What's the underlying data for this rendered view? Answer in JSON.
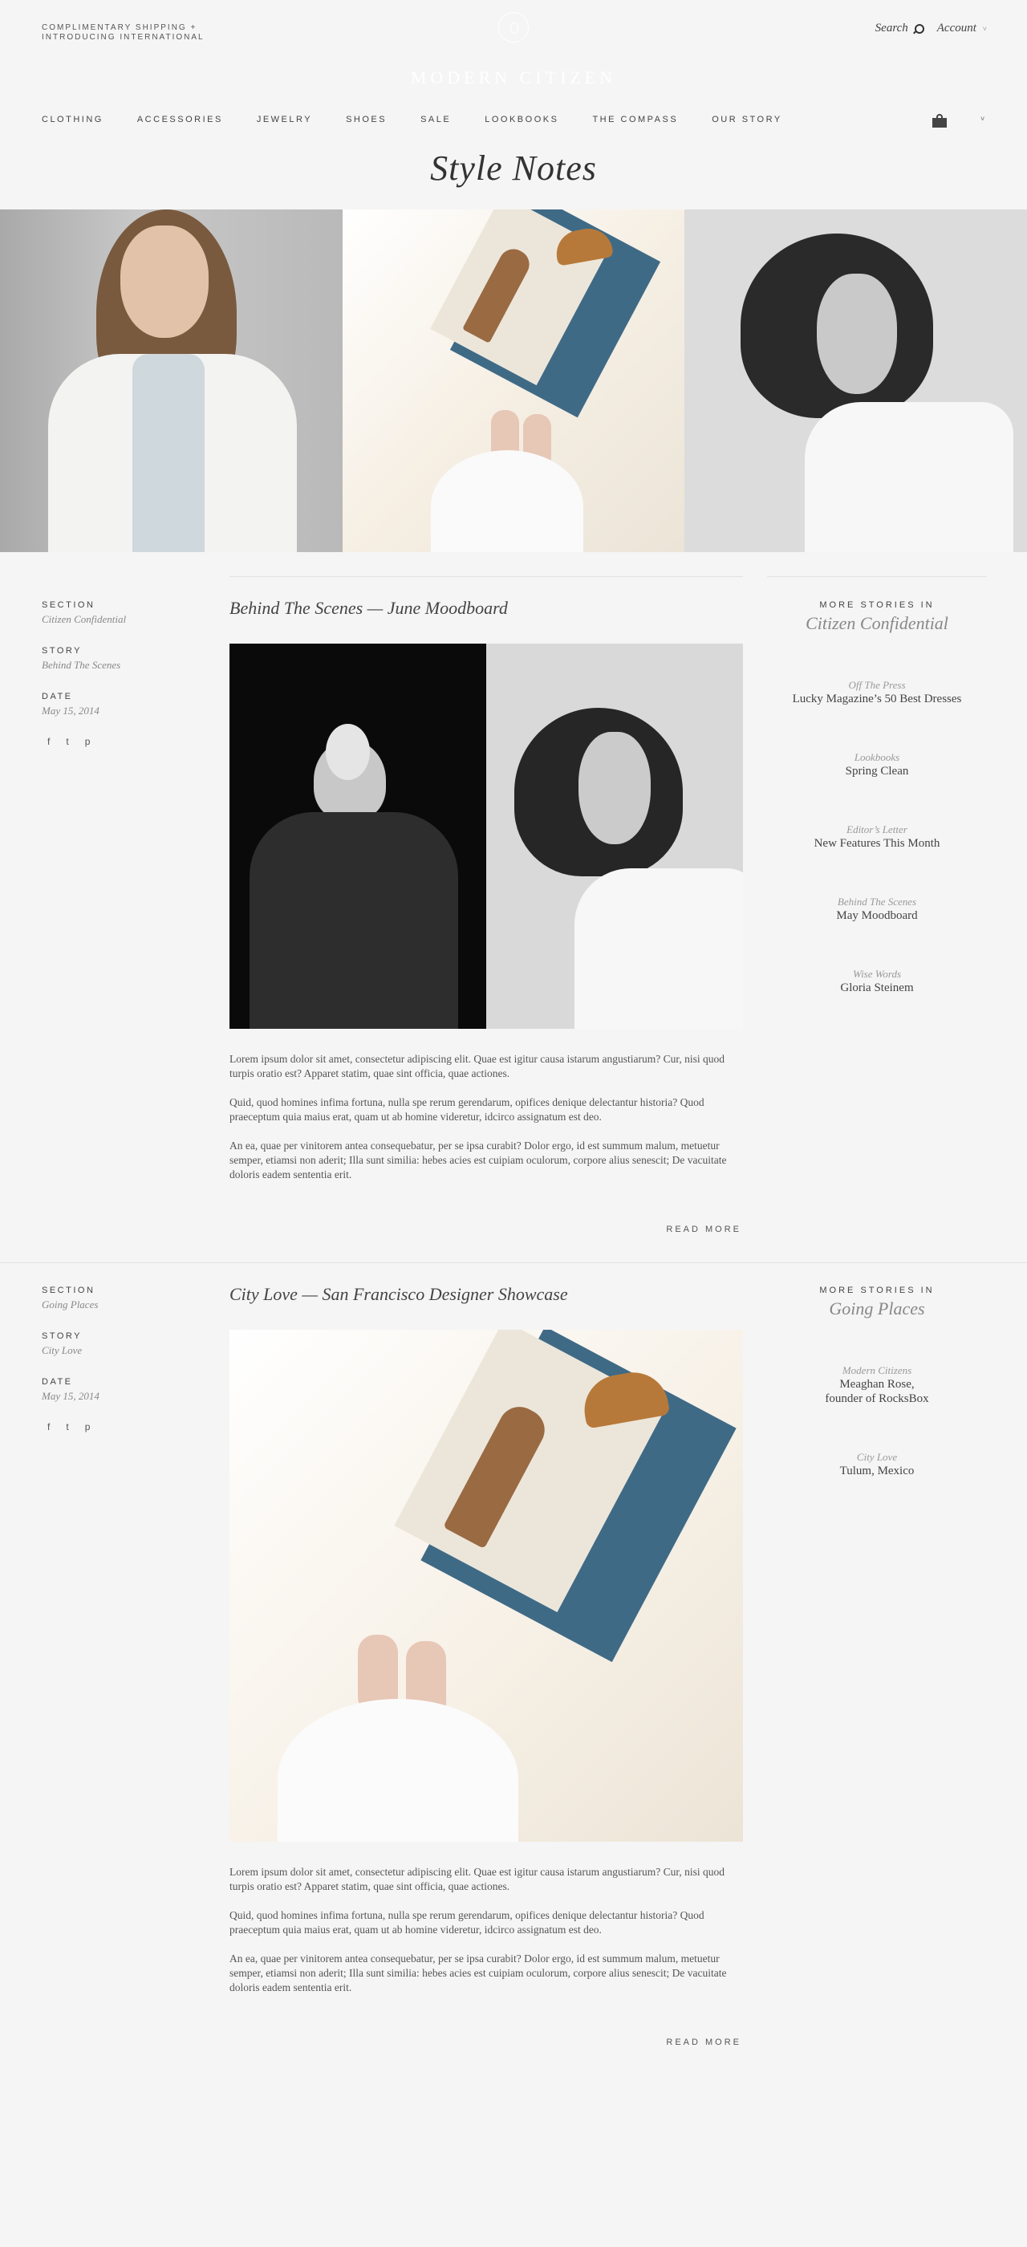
{
  "header": {
    "promo_line1": "COMPLIMENTARY SHIPPING +",
    "promo_line2": "INTRODUCING INTERNATIONAL",
    "wordmark": "MODERN CITIZEN",
    "search_label": "Search",
    "account_label": "Account",
    "chevron": "˅"
  },
  "nav": {
    "items": [
      "CLOTHING",
      "ACCESSORIES",
      "JEWELRY",
      "SHOES",
      "SALE",
      "LOOKBOOKS",
      "THE COMPASS",
      "OUR STORY"
    ]
  },
  "page": {
    "title": "Style Notes"
  },
  "articles": [
    {
      "section_label": "SECTION",
      "section": "Citizen Confidential",
      "story_label": "STORY",
      "story": "Behind The Scenes",
      "date_label": "DATE",
      "date": "May 15, 2014",
      "title": "Behind The Scenes — June Moodboard",
      "p1": "Lorem ipsum dolor sit amet, consectetur adipiscing elit. Quae est igitur causa istarum angustiarum?  Cur, nisi quod turpis oratio est? Apparet statim, quae sint officia, quae actiones.",
      "p2": "Quid, quod homines infima fortuna, nulla spe rerum gerendarum, opifices denique delectantur historia?  Quod praeceptum quia maius erat, quam ut ab homine videretur, idcirco assignatum est deo.",
      "p3": "An ea, quae per vinitorem antea consequebatur, per se ipsa curabit?  Dolor ergo, id est summum malum, metuetur semper, etiamsi non aderit; Illa sunt similia: hebes acies est cuipiam oculorum, corpore alius senescit; De vacuitate doloris eadem sententia erit.",
      "read_more": "READ MORE",
      "more_label": "MORE STORIES IN",
      "more_section": "Citizen Confidential",
      "stories": [
        {
          "cat": "Off The Press",
          "title": "Lucky Magazine’s 50 Best Dresses"
        },
        {
          "cat": "Lookbooks",
          "title": "Spring Clean"
        },
        {
          "cat": "Editor’s Letter",
          "title": "New Features This Month"
        },
        {
          "cat": "Behind The Scenes",
          "title": "May Moodboard"
        },
        {
          "cat": "Wise Words",
          "title": "Gloria Steinem"
        }
      ]
    },
    {
      "section_label": "SECTION",
      "section": "Going Places",
      "story_label": "STORY",
      "story": "City Love",
      "date_label": "DATE",
      "date": "May 15, 2014",
      "title": "City Love — San Francisco Designer Showcase",
      "p1": "Lorem ipsum dolor sit amet, consectetur adipiscing elit. Quae est igitur causa istarum angustiarum?  Cur, nisi quod turpis oratio est? Apparet statim, quae sint officia, quae actiones.",
      "p2": "Quid, quod homines infima fortuna, nulla spe rerum gerendarum, opifices denique delectantur historia?  Quod praeceptum quia maius erat, quam ut ab homine videretur, idcirco assignatum est deo.",
      "p3": "An ea, quae per vinitorem antea consequebatur, per se ipsa curabit?  Dolor ergo, id est summum malum, metuetur semper, etiamsi non aderit; Illa sunt similia: hebes acies est cuipiam oculorum, corpore alius senescit; De vacuitate doloris eadem sententia erit.",
      "read_more": "READ MORE",
      "more_label": "MORE STORIES IN",
      "more_section": "Going Places",
      "stories": [
        {
          "cat": "Modern Citizens",
          "title": "Meaghan Rose,",
          "title2": "founder of RocksBox"
        },
        {
          "cat": "City Love",
          "title": "Tulum, Mexico"
        }
      ]
    }
  ],
  "social": {
    "facebook": "f",
    "twitter": "t",
    "pinterest": "p"
  },
  "colors": {
    "background": "#f5f5f5",
    "text": "#3a3a3a",
    "muted": "#888888"
  }
}
